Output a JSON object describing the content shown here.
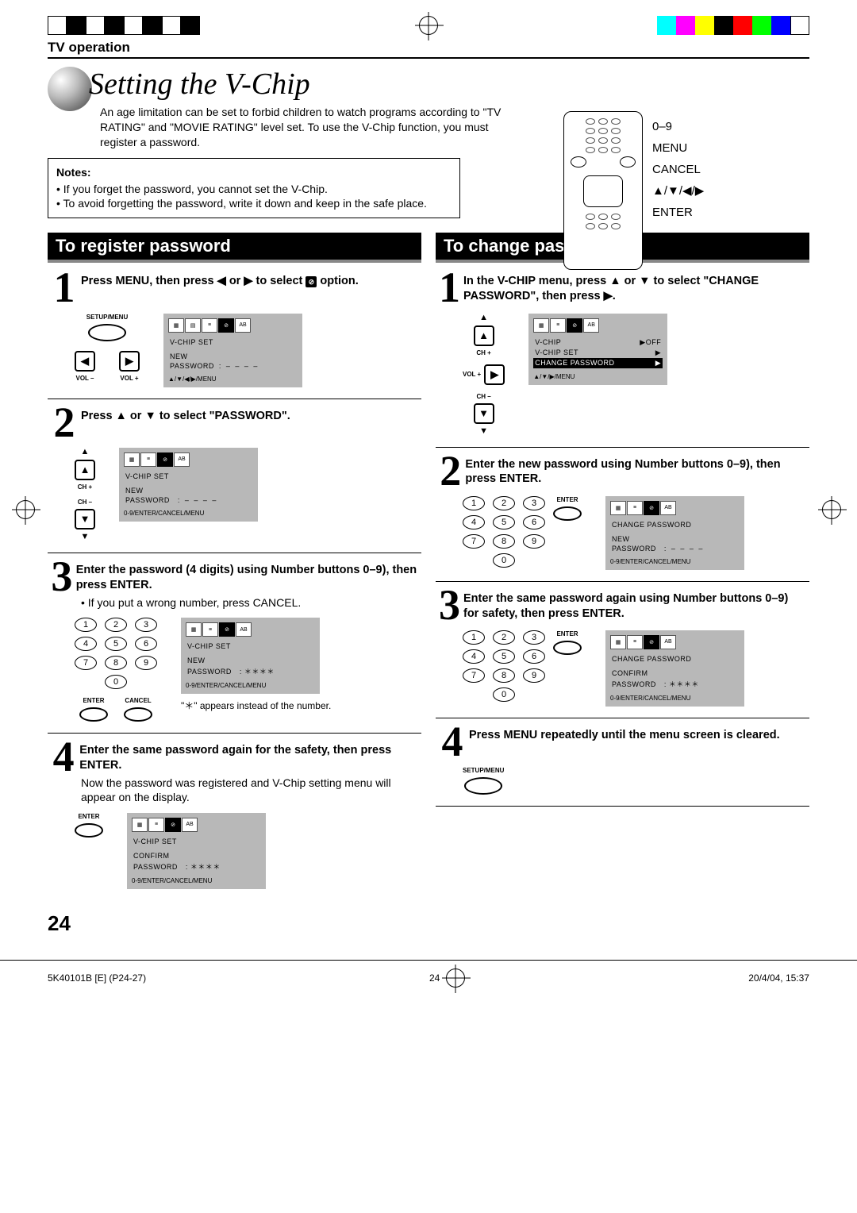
{
  "header": {
    "section": "TV operation"
  },
  "title": "Setting the V-Chip",
  "intro": "An age limitation can be set to forbid children to watch programs according to \"TV RATING\" and \"MOVIE RATING\" level set. To use the V-Chip function, you must register a password.",
  "notes": {
    "heading": "Notes:",
    "items": [
      "If you forget the password, you cannot set the V-Chip.",
      "To avoid forgetting the password, write it down and keep in the safe place."
    ]
  },
  "remote_labels": {
    "l1": "0–9",
    "l2": "MENU",
    "l3": "CANCEL",
    "l4": "▲/▼/◀/▶",
    "l5": "ENTER"
  },
  "left": {
    "title": "To register password",
    "s1": {
      "text": "Press MENU, then press ◀ or ▶ to select ",
      "icon_name": "vchip-icon",
      "text2": " option.",
      "remote": {
        "setup": "SETUP/MENU",
        "vol_minus": "VOL –",
        "vol_plus": "VOL +"
      },
      "osd": {
        "h": "V-CHIP SET",
        "l1": "NEW",
        "l2": "PASSWORD",
        "dash": ": – – – –",
        "foot": "▲/▼/◀/▶/MENU"
      }
    },
    "s2": {
      "text": "Press ▲ or ▼ to select \"PASSWORD\".",
      "remote": {
        "ch_plus": "CH +",
        "ch_minus": "CH –"
      },
      "osd": {
        "h": "V-CHIP SET",
        "l1": "NEW",
        "l2": "PASSWORD",
        "dash": ": – – – –",
        "foot": "0-9/ENTER/CANCEL/MENU"
      }
    },
    "s3": {
      "text": "Enter the password (4 digits) using Number buttons 0–9), then press ENTER.",
      "sub": "If you put a wrong number, press CANCEL.",
      "remote": {
        "enter": "ENTER",
        "cancel": "CANCEL"
      },
      "osd": {
        "h": "V-CHIP SET",
        "l1": "NEW",
        "l2": "PASSWORD",
        "dash": ": ＊＊＊＊",
        "foot": "0-9/ENTER/CANCEL/MENU"
      },
      "footnote": "\"＊\" appears instead of the number."
    },
    "s4": {
      "text": "Enter the same password again for the safety, then press ENTER.",
      "sub": "Now the password was registered and V-Chip setting menu will appear on the display.",
      "remote": {
        "enter": "ENTER"
      },
      "osd": {
        "h": "V-CHIP SET",
        "l1": "CONFIRM",
        "l2": "PASSWORD",
        "dash": ": ＊＊＊＊",
        "foot": "0-9/ENTER/CANCEL/MENU"
      }
    }
  },
  "right": {
    "title": "To change password",
    "s1": {
      "text": "In the V-CHIP menu, press ▲ or ▼ to select \"CHANGE PASSWORD\", then press ▶.",
      "remote": {
        "ch_plus": "CH +",
        "vol_plus": "VOL +",
        "ch_minus": "CH –"
      },
      "osd": {
        "l1": "V-CHIP",
        "l1r": "▶OFF",
        "l2": "V-CHIP SET",
        "l2r": "▶",
        "l3": "CHANGE PASSWORD",
        "l3r": "▶",
        "foot": "▲/▼/▶/MENU"
      }
    },
    "s2": {
      "text": "Enter the new password using Number buttons 0–9), then press ENTER.",
      "remote": {
        "enter": "ENTER"
      },
      "osd": {
        "h": "CHANGE PASSWORD",
        "l1": "NEW",
        "l2": "PASSWORD",
        "dash": ": – – – –",
        "foot": "0-9/ENTER/CANCEL/MENU"
      }
    },
    "s3": {
      "text": "Enter the same password again using Number buttons 0–9) for safety, then press ENTER.",
      "remote": {
        "enter": "ENTER"
      },
      "osd": {
        "h": "CHANGE PASSWORD",
        "l1": "CONFIRM",
        "l2": "PASSWORD",
        "dash": ": ＊＊＊＊",
        "foot": "0-9/ENTER/CANCEL/MENU"
      }
    },
    "s4": {
      "text": "Press MENU repeatedly until the menu screen is cleared.",
      "remote": {
        "setup": "SETUP/MENU"
      }
    }
  },
  "page_number": "24",
  "footer": {
    "left": "5K40101B [E] (P24-27)",
    "center": "24",
    "right": "20/4/04, 15:37"
  },
  "keypad": [
    "1",
    "2",
    "3",
    "4",
    "5",
    "6",
    "7",
    "8",
    "9",
    "0"
  ]
}
